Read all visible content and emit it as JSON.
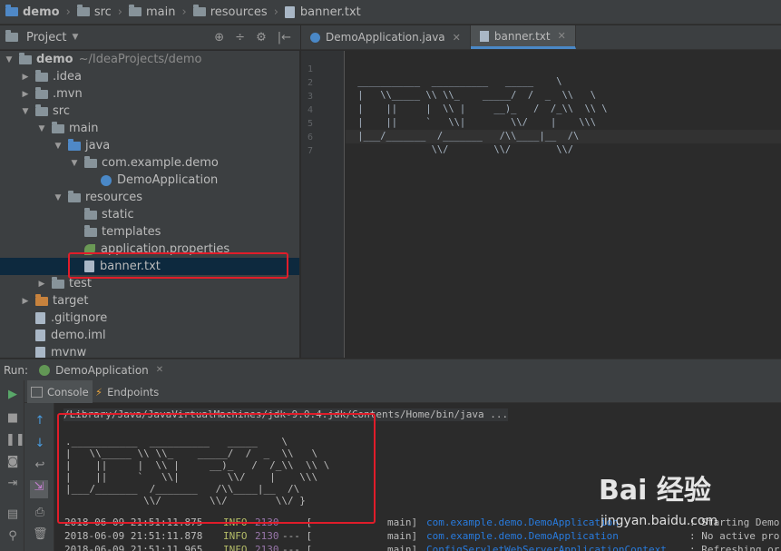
{
  "breadcrumb": [
    "demo",
    "src",
    "main",
    "resources",
    "banner.txt"
  ],
  "project_panel": {
    "title": "Project",
    "tools": [
      "⊕",
      "÷",
      "⚙",
      "|←"
    ]
  },
  "tree": [
    {
      "label": "demo",
      "extra": "~/IdeaProjects/demo",
      "depth": 0,
      "arrow": "▼",
      "icon": "folder",
      "bold": true
    },
    {
      "label": ".idea",
      "depth": 1,
      "arrow": "▶",
      "icon": "folder"
    },
    {
      "label": ".mvn",
      "depth": 1,
      "arrow": "▶",
      "icon": "folder"
    },
    {
      "label": "src",
      "depth": 1,
      "arrow": "▼",
      "icon": "folder"
    },
    {
      "label": "main",
      "depth": 2,
      "arrow": "▼",
      "icon": "folder"
    },
    {
      "label": "java",
      "depth": 3,
      "arrow": "▼",
      "icon": "folder-blue"
    },
    {
      "label": "com.example.demo",
      "depth": 4,
      "arrow": "▼",
      "icon": "folder"
    },
    {
      "label": "DemoApplication",
      "depth": 5,
      "arrow": "",
      "icon": "class"
    },
    {
      "label": "resources",
      "depth": 3,
      "arrow": "▼",
      "icon": "folder-res"
    },
    {
      "label": "static",
      "depth": 4,
      "arrow": "",
      "icon": "folder"
    },
    {
      "label": "templates",
      "depth": 4,
      "arrow": "",
      "icon": "folder"
    },
    {
      "label": "application.properties",
      "depth": 4,
      "arrow": "",
      "icon": "leaf"
    },
    {
      "label": "banner.txt",
      "depth": 4,
      "arrow": "",
      "icon": "file",
      "selected": true
    },
    {
      "label": "test",
      "depth": 2,
      "arrow": "▶",
      "icon": "folder"
    },
    {
      "label": "target",
      "depth": 1,
      "arrow": "▶",
      "icon": "folder-orange"
    },
    {
      "label": ".gitignore",
      "depth": 1,
      "arrow": "",
      "icon": "file"
    },
    {
      "label": "demo.iml",
      "depth": 1,
      "arrow": "",
      "icon": "file"
    },
    {
      "label": "mvnw",
      "depth": 1,
      "arrow": "",
      "icon": "file"
    }
  ],
  "editor_tabs": [
    {
      "label": "DemoApplication.java",
      "active": false
    },
    {
      "label": "banner.txt",
      "active": true
    }
  ],
  "editor_lines": [
    "",
    " ___________  __________   _____    \\",
    " |   \\\\_____ \\\\ \\\\_    _____/  /  _  \\\\   \\",
    " |    ||     |  \\\\ |     __)_   /  /_\\\\  \\\\ \\",
    " |    ||     `   \\\\|        \\\\/    |    \\\\\\",
    " |___/_______  /_______   /\\\\____|__  /\\",
    "              \\\\/        \\\\/        \\\\/"
  ],
  "run": {
    "label": "Run:",
    "config": "DemoApplication",
    "tabs": [
      "Console",
      "Endpoints"
    ],
    "path_line": "/Library/Java/JavaVirtualMachines/jdk-9.0.4.jdk/Contents/Home/bin/java ...",
    "banner": [
      ".___________  __________   _____    \\",
      "|   \\\\_____ \\\\ \\\\_    _____/  /  _  \\\\   \\",
      "|    ||     |  \\\\ |     __)_   /  /_\\\\  \\\\ \\",
      "|    ||     `   \\\\|        \\\\/    |    \\\\\\",
      "|___/_______  /_______   /\\\\____|__  /\\",
      "             \\\\/        \\\\/        \\\\/ }"
    ],
    "logs": [
      {
        "time": "2018-06-09 21:51:11.875",
        "level": "INFO",
        "pid": "2130",
        "sep": "--- [",
        "thread": "main]",
        "logger": "com.example.demo.DemoApplication",
        "msg": ": Starting Demo"
      },
      {
        "time": "2018-06-09 21:51:11.878",
        "level": "INFO",
        "pid": "2130",
        "sep": "--- [",
        "thread": "main]",
        "logger": "com.example.demo.DemoApplication",
        "msg": ": No active pro"
      },
      {
        "time": "2018-06-09 21:51:11.965",
        "level": "INFO",
        "pid": "2130",
        "sep": "--- [",
        "thread": "main]",
        "logger": "ConfigServletWebServerApplicationContext",
        "msg": ": Refreshing or"
      }
    ]
  },
  "watermark": {
    "logo": "Bai 经验",
    "url": "jingyan.baidu.com"
  },
  "colors": {
    "logger": "#287bde",
    "info": "#b5bd68",
    "pid": "#9876aa",
    "highlight_box": "#e01d2a"
  }
}
